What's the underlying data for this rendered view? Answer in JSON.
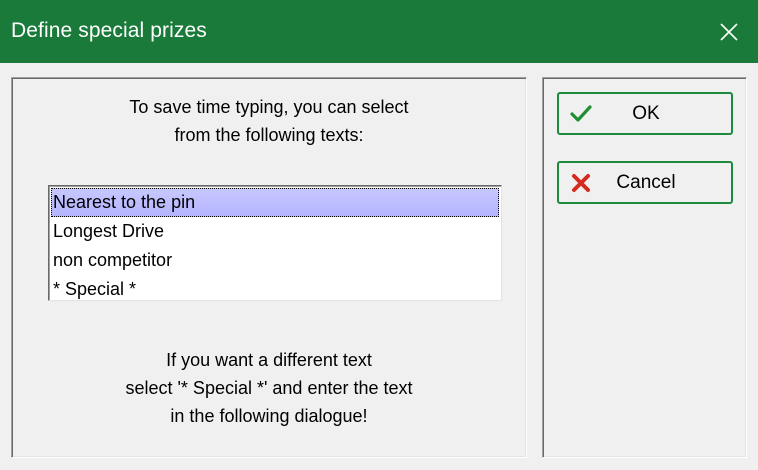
{
  "window": {
    "title": "Define special prizes",
    "accent_color": "#1a7a3a"
  },
  "left_panel": {
    "instruction_top": [
      "To save time typing, you can select",
      "from the following texts:"
    ],
    "list": {
      "items": [
        "Nearest to the pin",
        "Longest Drive",
        "non competitor",
        "* Special *"
      ],
      "selected_index": 0
    },
    "instruction_bottom": [
      "If you want a different text",
      "select '* Special *' and enter the text",
      "in the following dialogue!"
    ]
  },
  "buttons": {
    "ok": {
      "label": "OK",
      "icon": "checkmark-icon"
    },
    "cancel": {
      "label": "Cancel",
      "icon": "x-icon"
    }
  }
}
